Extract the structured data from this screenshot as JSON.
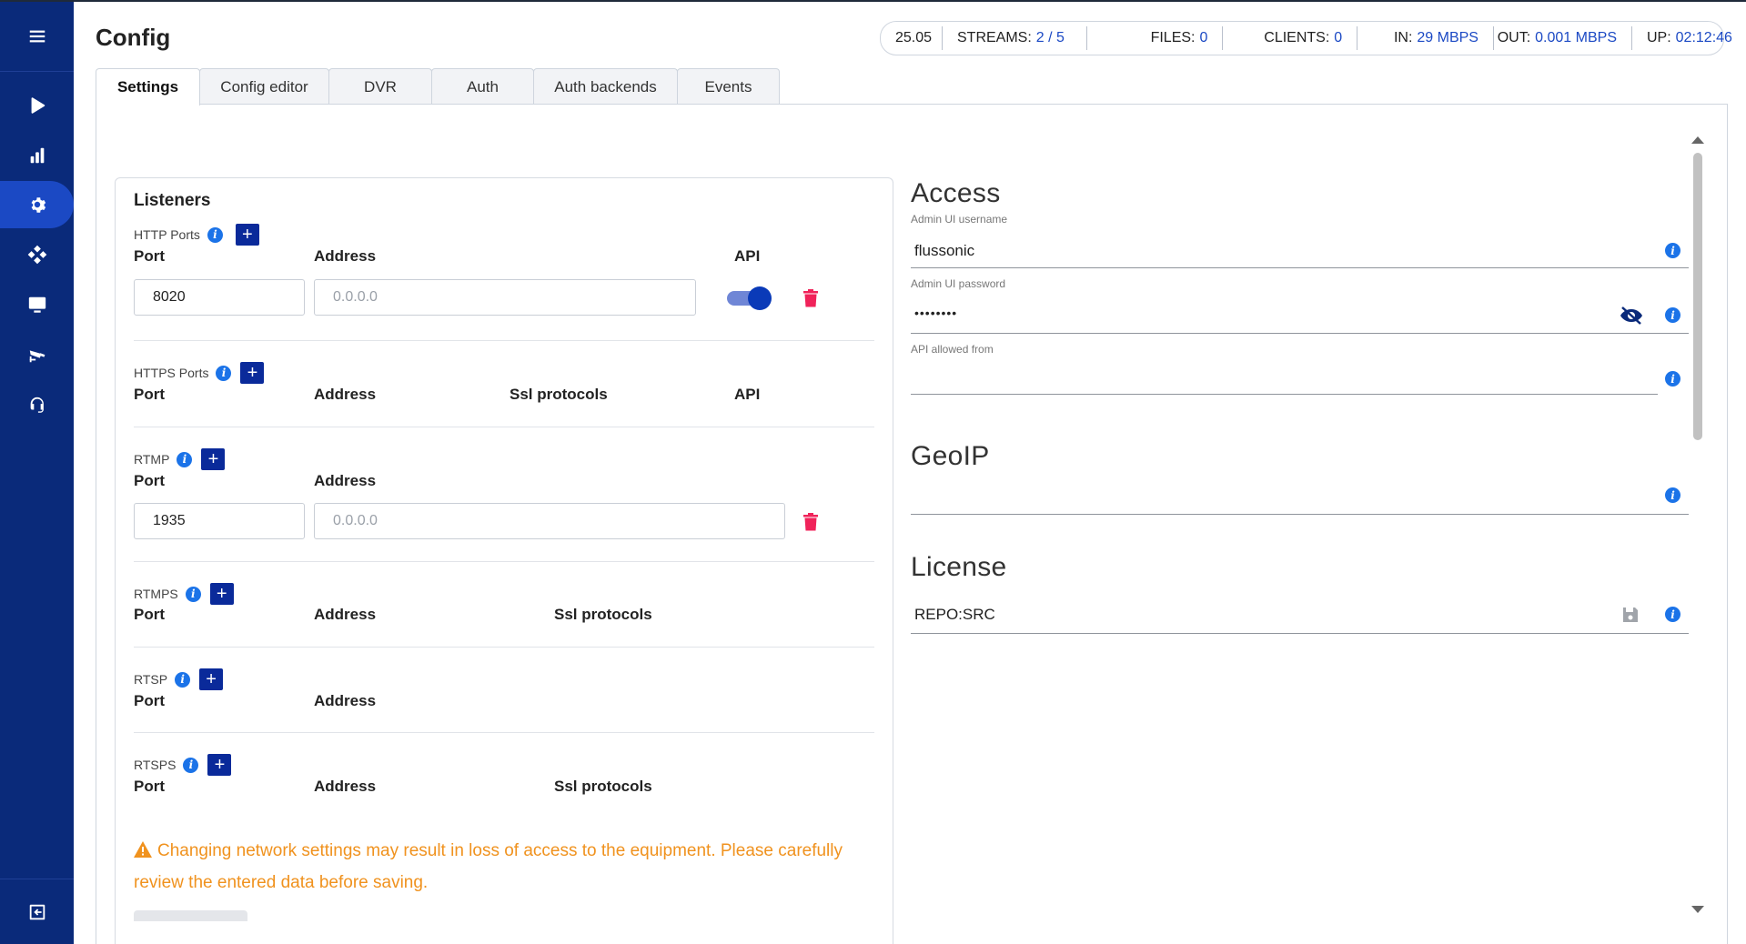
{
  "page": {
    "title": "Config"
  },
  "stats": {
    "version": "25.05",
    "streams_label": "STREAMS:",
    "streams_value": "2 / 5",
    "files_label": "FILES:",
    "files_value": "0",
    "clients_label": "CLIENTS:",
    "clients_value": "0",
    "in_label": "IN:",
    "in_value": "29 MBPS",
    "out_label": "OUT:",
    "out_value": "0.001 MBPS",
    "up_label": "UP:",
    "up_value": "02:12:46"
  },
  "tabs": [
    {
      "label": "Settings",
      "active": true
    },
    {
      "label": "Config editor"
    },
    {
      "label": "DVR"
    },
    {
      "label": "Auth"
    },
    {
      "label": "Auth backends"
    },
    {
      "label": "Events"
    }
  ],
  "sidebar": {
    "items": [
      "menu-icon",
      "play-icon",
      "stats-icon",
      "gear-icon",
      "puzzle-icon",
      "monitor-icon",
      "camera-icon",
      "headset-icon",
      "logout-icon"
    ],
    "active": "gear-icon"
  },
  "listeners": {
    "title": "Listeners",
    "http": {
      "label": "HTTP Ports",
      "col_port": "Port",
      "col_address": "Address",
      "col_api": "API",
      "row": {
        "port": "8020",
        "address_placeholder": "0.0.0.0",
        "api": true
      }
    },
    "https": {
      "label": "HTTPS Ports",
      "col_port": "Port",
      "col_address": "Address",
      "col_ssl": "Ssl protocols",
      "col_api": "API"
    },
    "rtmp": {
      "label": "RTMP",
      "col_port": "Port",
      "col_address": "Address",
      "row": {
        "port": "1935",
        "address_placeholder": "0.0.0.0"
      }
    },
    "rtmps": {
      "label": "RTMPS",
      "col_port": "Port",
      "col_address": "Address",
      "col_ssl": "Ssl protocols"
    },
    "rtsp": {
      "label": "RTSP",
      "col_port": "Port",
      "col_address": "Address"
    },
    "rtsps": {
      "label": "RTSPS",
      "col_port": "Port",
      "col_address": "Address",
      "col_ssl": "Ssl protocols"
    },
    "warning": "Changing network settings may result in loss of access to the equipment. Please carefully review the entered data before saving."
  },
  "access": {
    "title": "Access",
    "username_label": "Admin UI username",
    "username_value": "flussonic",
    "password_label": "Admin UI password",
    "password_value": "••••••••",
    "api_allowed_label": "API allowed from",
    "api_allowed_value": ""
  },
  "geoip": {
    "title": "GeoIP"
  },
  "license": {
    "title": "License",
    "value": "REPO:SRC"
  },
  "colors": {
    "sidebar": "#0a2a7a",
    "accent": "#1b49c4",
    "warning": "#f0921e",
    "danger": "#f0235a"
  }
}
